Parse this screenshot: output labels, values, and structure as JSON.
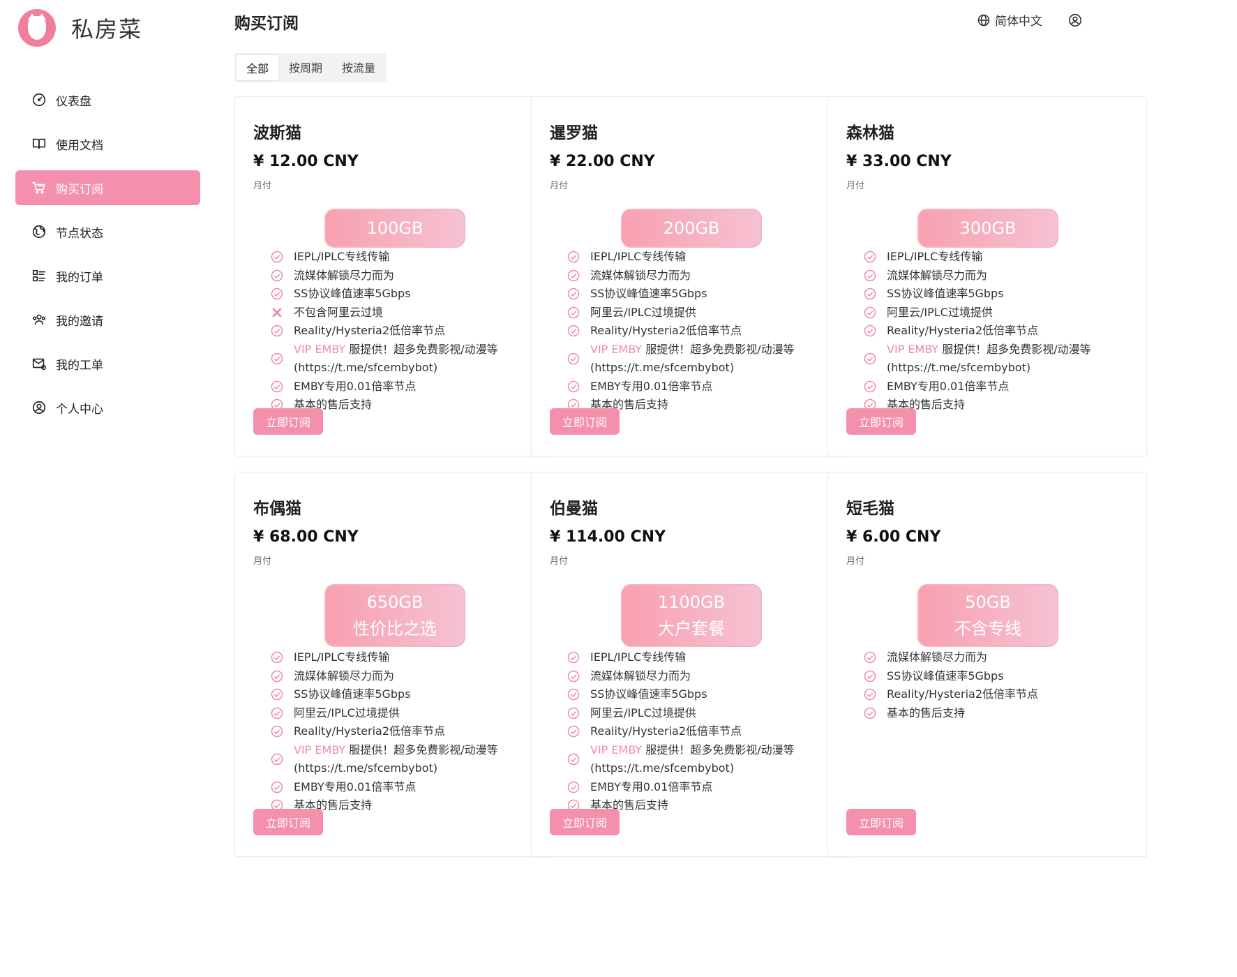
{
  "brand": {
    "name": "私房菜"
  },
  "nav": [
    {
      "label": "仪表盘",
      "icon": "dashboard-icon"
    },
    {
      "label": "使用文档",
      "icon": "book-icon"
    },
    {
      "label": "购买订阅",
      "icon": "cart-icon",
      "active": true
    },
    {
      "label": "节点状态",
      "icon": "globe-icon"
    },
    {
      "label": "我的订单",
      "icon": "list-icon"
    },
    {
      "label": "我的邀请",
      "icon": "people-icon"
    },
    {
      "label": "我的工单",
      "icon": "mail-icon"
    },
    {
      "label": "个人中心",
      "icon": "user-circle-icon"
    }
  ],
  "header": {
    "title": "购买订阅",
    "language": "简体中文"
  },
  "tabs": [
    {
      "label": "全部",
      "active": true
    },
    {
      "label": "按周期"
    },
    {
      "label": "按流量"
    }
  ],
  "accent_color": "#f48fac",
  "plans": [
    {
      "name": "波斯猫",
      "price": "¥ 12.00 CNY",
      "period": "月付",
      "badge": [
        "100GB"
      ],
      "features": [
        {
          "ok": true,
          "text": "IEPL/IPLC专线传输"
        },
        {
          "ok": true,
          "text": "流媒体解锁尽力而为"
        },
        {
          "ok": true,
          "text": "SS协议峰值速率5Gbps"
        },
        {
          "ok": false,
          "text": "不包含阿里云过境"
        },
        {
          "ok": true,
          "text": "Reality/Hysteria2低倍率节点"
        },
        {
          "ok": true,
          "highlight": "VIP EMBY",
          "text": " 服提供！超多免费影视/动漫等(https://t.me/sfcembybot)"
        },
        {
          "ok": true,
          "text": "EMBY专用0.01倍率节点"
        },
        {
          "ok": true,
          "text": "基本的售后支持"
        }
      ],
      "button": "立即订阅"
    },
    {
      "name": "暹罗猫",
      "price": "¥ 22.00 CNY",
      "period": "月付",
      "badge": [
        "200GB"
      ],
      "features": [
        {
          "ok": true,
          "text": "IEPL/IPLC专线传输"
        },
        {
          "ok": true,
          "text": "流媒体解锁尽力而为"
        },
        {
          "ok": true,
          "text": "SS协议峰值速率5Gbps"
        },
        {
          "ok": true,
          "text": "阿里云/IPLC过境提供"
        },
        {
          "ok": true,
          "text": "Reality/Hysteria2低倍率节点"
        },
        {
          "ok": true,
          "highlight": "VIP EMBY",
          "text": " 服提供！超多免费影视/动漫等(https://t.me/sfcembybot)"
        },
        {
          "ok": true,
          "text": "EMBY专用0.01倍率节点"
        },
        {
          "ok": true,
          "text": "基本的售后支持"
        }
      ],
      "button": "立即订阅"
    },
    {
      "name": "森林猫",
      "price": "¥ 33.00 CNY",
      "period": "月付",
      "badge": [
        "300GB"
      ],
      "features": [
        {
          "ok": true,
          "text": "IEPL/IPLC专线传输"
        },
        {
          "ok": true,
          "text": "流媒体解锁尽力而为"
        },
        {
          "ok": true,
          "text": "SS协议峰值速率5Gbps"
        },
        {
          "ok": true,
          "text": "阿里云/IPLC过境提供"
        },
        {
          "ok": true,
          "text": "Reality/Hysteria2低倍率节点"
        },
        {
          "ok": true,
          "highlight": "VIP EMBY",
          "text": " 服提供！超多免费影视/动漫等(https://t.me/sfcembybot)"
        },
        {
          "ok": true,
          "text": "EMBY专用0.01倍率节点"
        },
        {
          "ok": true,
          "text": "基本的售后支持"
        }
      ],
      "button": "立即订阅"
    },
    {
      "name": "布偶猫",
      "price": "¥ 68.00 CNY",
      "period": "月付",
      "badge": [
        "650GB",
        "性价比之选"
      ],
      "features": [
        {
          "ok": true,
          "text": "IEPL/IPLC专线传输"
        },
        {
          "ok": true,
          "text": "流媒体解锁尽力而为"
        },
        {
          "ok": true,
          "text": "SS协议峰值速率5Gbps"
        },
        {
          "ok": true,
          "text": "阿里云/IPLC过境提供"
        },
        {
          "ok": true,
          "text": "Reality/Hysteria2低倍率节点"
        },
        {
          "ok": true,
          "highlight": "VIP EMBY",
          "text": " 服提供！超多免费影视/动漫等(https://t.me/sfcembybot)"
        },
        {
          "ok": true,
          "text": "EMBY专用0.01倍率节点"
        },
        {
          "ok": true,
          "text": "基本的售后支持"
        }
      ],
      "button": "立即订阅"
    },
    {
      "name": "伯曼猫",
      "price": "¥ 114.00 CNY",
      "period": "月付",
      "badge": [
        "1100GB",
        "大户套餐"
      ],
      "features": [
        {
          "ok": true,
          "text": "IEPL/IPLC专线传输"
        },
        {
          "ok": true,
          "text": "流媒体解锁尽力而为"
        },
        {
          "ok": true,
          "text": "SS协议峰值速率5Gbps"
        },
        {
          "ok": true,
          "text": "阿里云/IPLC过境提供"
        },
        {
          "ok": true,
          "text": "Reality/Hysteria2低倍率节点"
        },
        {
          "ok": true,
          "highlight": "VIP EMBY",
          "text": " 服提供！超多免费影视/动漫等(https://t.me/sfcembybot)"
        },
        {
          "ok": true,
          "text": "EMBY专用0.01倍率节点"
        },
        {
          "ok": true,
          "text": "基本的售后支持"
        }
      ],
      "button": "立即订阅"
    },
    {
      "name": "短毛猫",
      "price": "¥ 6.00 CNY",
      "period": "月付",
      "badge": [
        "50GB",
        "不含专线"
      ],
      "features": [
        {
          "ok": true,
          "text": "流媒体解锁尽力而为"
        },
        {
          "ok": true,
          "text": "SS协议峰值速率5Gbps"
        },
        {
          "ok": true,
          "text": "Reality/Hysteria2低倍率节点"
        },
        {
          "ok": true,
          "text": "基本的售后支持"
        }
      ],
      "button": "立即订阅"
    }
  ]
}
